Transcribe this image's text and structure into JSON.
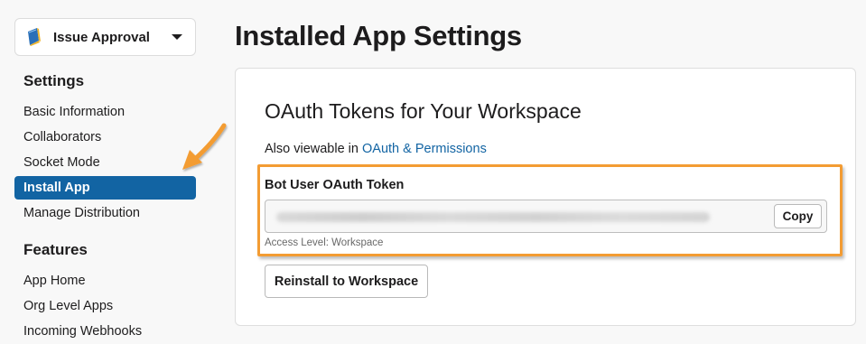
{
  "sidebar": {
    "app_picker": {
      "name": "Issue Approval"
    },
    "sections": [
      {
        "title": "Settings",
        "items": [
          {
            "label": "Basic Information",
            "active": false
          },
          {
            "label": "Collaborators",
            "active": false
          },
          {
            "label": "Socket Mode",
            "active": false
          },
          {
            "label": "Install App",
            "active": true
          },
          {
            "label": "Manage Distribution",
            "active": false
          }
        ]
      },
      {
        "title": "Features",
        "items": [
          {
            "label": "App Home",
            "active": false
          },
          {
            "label": "Org Level Apps",
            "active": false
          },
          {
            "label": "Incoming Webhooks",
            "active": false
          }
        ]
      }
    ]
  },
  "main": {
    "page_title": "Installed App Settings",
    "card": {
      "title": "OAuth Tokens for Your Workspace",
      "subtitle_prefix": "Also viewable in",
      "subtitle_link": "OAuth & Permissions",
      "token": {
        "label": "Bot User OAuth Token",
        "copy_label": "Copy",
        "access_level": "Access Level: Workspace"
      },
      "reinstall_label": "Reinstall to Workspace"
    }
  },
  "colors": {
    "accent": "#1264a3",
    "highlight": "#f39c33",
    "text": "#1d1c1d"
  },
  "icons": {
    "app_icon": "app-book-icon",
    "picker_caret": "chevron-down-icon",
    "annotation_arrow": "arrow-icon"
  }
}
